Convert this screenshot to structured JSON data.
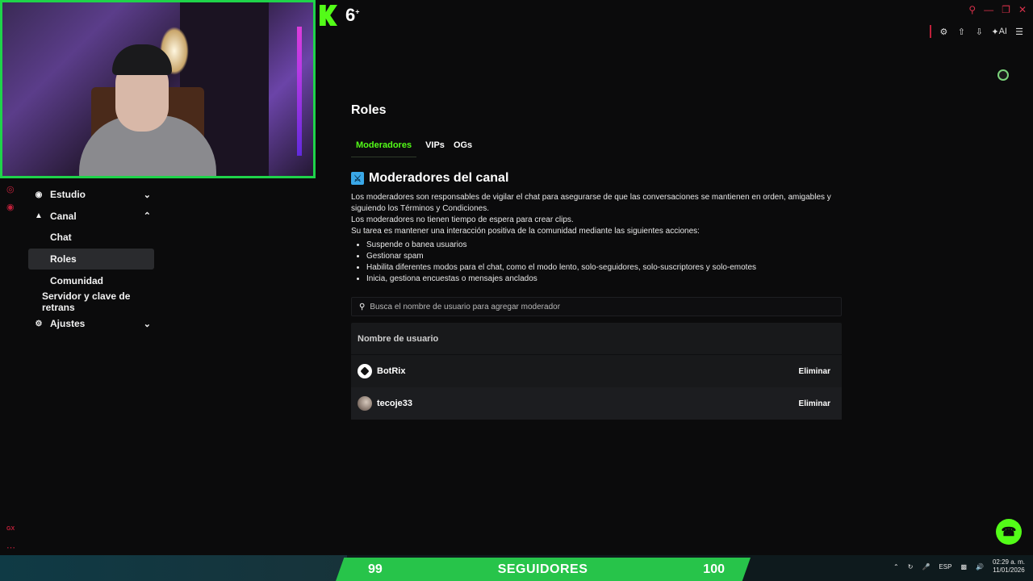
{
  "app": {
    "badge": "6",
    "badge_sup": "+"
  },
  "toolbar": {
    "ai_label": "AI"
  },
  "sidebar": {
    "items": [
      {
        "label": "Estudio"
      },
      {
        "label": "Canal"
      },
      {
        "label": "Chat"
      },
      {
        "label": "Roles"
      },
      {
        "label": "Comunidad"
      },
      {
        "label": "Servidor y clave de retrans"
      },
      {
        "label": "Ajustes"
      }
    ]
  },
  "main": {
    "title": "Roles",
    "tabs": [
      {
        "label": "Moderadores"
      },
      {
        "label": "VIPs"
      },
      {
        "label": "OGs"
      }
    ],
    "section_title": "Moderadores del canal",
    "desc": [
      "Los moderadores son responsables de vigilar el chat para asegurarse de que las conversaciones se mantienen en orden, amigables y siguiendo los Términos y Condiciones.",
      "Los moderadores no tienen tiempo de espera para crear clips.",
      "Su tarea es mantener una interacción positiva de la comunidad mediante las siguientes acciones:"
    ],
    "bullets": [
      "Suspende o banea usuarios",
      "Gestionar spam",
      "Habilita diferentes modos para el chat, como el modo lento, solo-seguidores, solo-suscriptores y solo-emotes",
      "Inicia, gestiona encuestas o mensajes anclados"
    ],
    "search_placeholder": "Busca el nombre de usuario para agregar moderador",
    "table": {
      "header": "Nombre de usuario",
      "rows": [
        {
          "username": "BotRix",
          "action": "Eliminar"
        },
        {
          "username": "tecoje33",
          "action": "Eliminar"
        }
      ]
    }
  },
  "followers_bar": {
    "current": "99",
    "label": "SEGUIDORES",
    "goal": "100"
  },
  "gutter": {
    "gx": "GX"
  },
  "tray": {
    "lang": "ESP",
    "time": "02:29 a. m.",
    "date": "11/01/2026"
  },
  "colors": {
    "accent": "#53fc18",
    "danger": "#c0203a",
    "webcam_border": "#1fd34a"
  }
}
